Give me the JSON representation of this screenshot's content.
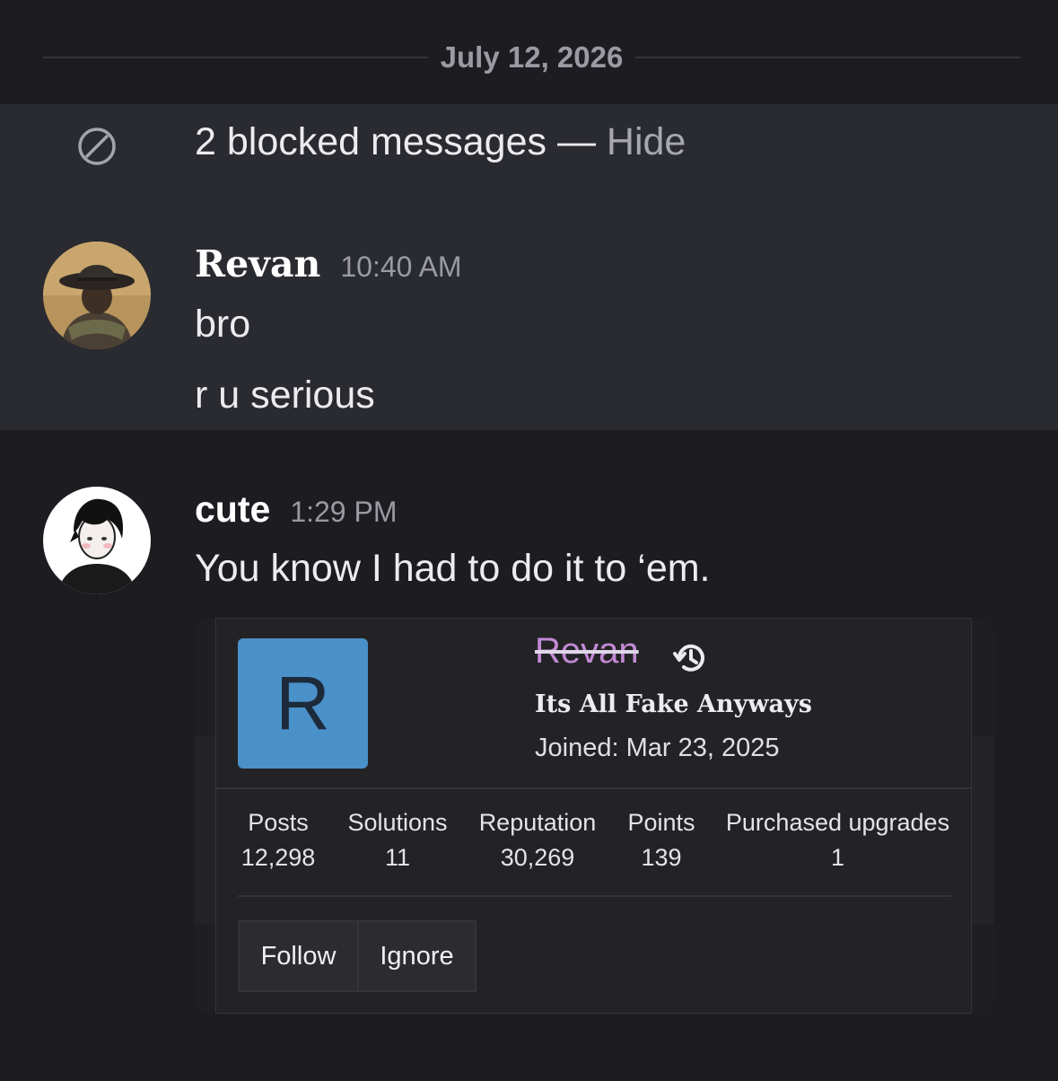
{
  "date_divider": "July 12, 2026",
  "blocked": {
    "text": "2 blocked messages —",
    "hide_label": "Hide"
  },
  "messages": [
    {
      "author": "Revan",
      "time": "10:40 AM",
      "lines": [
        "bro",
        "r u serious"
      ]
    },
    {
      "author": "cute",
      "time": "1:29 PM",
      "lines": [
        "You know I had to do it to ‘em."
      ]
    }
  ],
  "profile_card": {
    "avatar_letter": "R",
    "username": "Revan",
    "title": "Its All Fake Anyways",
    "joined": "Joined: Mar 23, 2025",
    "stats": [
      {
        "label": "Posts",
        "value": "12,298"
      },
      {
        "label": "Solutions",
        "value": "11"
      },
      {
        "label": "Reputation",
        "value": "30,269"
      },
      {
        "label": "Points",
        "value": "139"
      },
      {
        "label": "Purchased upgrades",
        "value": "1"
      }
    ],
    "buttons": {
      "follow": "Follow",
      "ignore": "Ignore"
    }
  },
  "colors": {
    "background": "#1c1c21",
    "blocked_band": "#2a2a31",
    "avatar_blue": "#4a90c9",
    "username_purple": "#c38ad6"
  },
  "icons": [
    "blocked-icon",
    "history-icon"
  ]
}
